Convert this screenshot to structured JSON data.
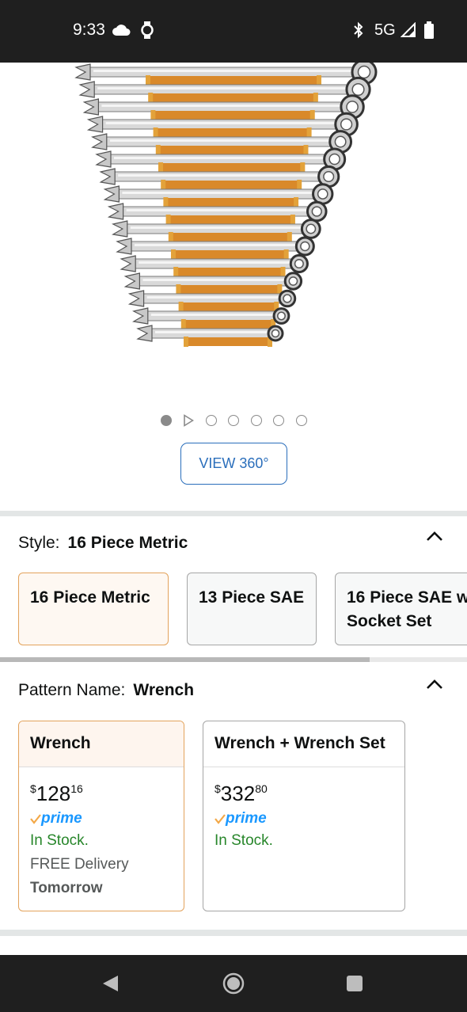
{
  "status_bar": {
    "time": "9:33",
    "network": "5G",
    "icons": [
      "cloud-icon",
      "watch-icon",
      "bluetooth-icon",
      "signal-icon",
      "battery-icon"
    ]
  },
  "carousel": {
    "image_alt": "16 piece metric ratcheting wrench set",
    "dot_count": 7,
    "active_index": 0,
    "view_360_label": "VIEW 360°"
  },
  "style": {
    "label": "Style:",
    "selected": "16 Piece Metric",
    "options": [
      {
        "line1": "16 Piece Metric",
        "line2": ""
      },
      {
        "line1": "13 Piece SAE",
        "line2": ""
      },
      {
        "line1": "16 Piece SAE w",
        "line2": "Socket Set"
      }
    ]
  },
  "pattern": {
    "label": "Pattern Name:",
    "selected": "Wrench",
    "options": [
      {
        "name": "Wrench",
        "price_symbol": "$",
        "price_whole": "128",
        "price_cents": "16",
        "prime": "prime",
        "stock": "In Stock.",
        "delivery": "FREE Delivery",
        "delivery_day": "Tomorrow"
      },
      {
        "name": "Wrench + Wrench Set",
        "price_symbol": "$",
        "price_whole": "332",
        "price_cents": "80",
        "prime": "prime",
        "stock": "In Stock.",
        "delivery": "",
        "delivery_day": ""
      }
    ]
  },
  "colors": {
    "accent_blue": "#2a6ebb",
    "selected_border": "#e3a35c",
    "stock_green": "#27862a",
    "prime_blue": "#1a98ff",
    "prime_check": "#f3a847"
  },
  "nav_bar": {
    "icons": [
      "back-icon",
      "home-icon",
      "recents-icon"
    ]
  }
}
